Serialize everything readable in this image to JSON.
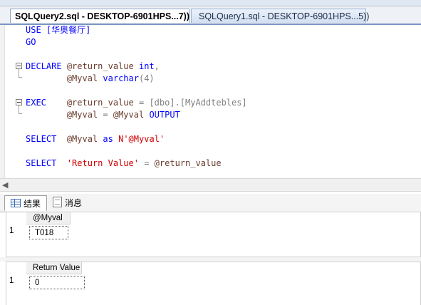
{
  "window": {
    "tabs": [
      {
        "label": "SQLQuery2.sql - DESKTOP-6901HPS...7))",
        "active": true
      },
      {
        "label": "SQLQuery1.sql - DESKTOP-6901HPS...5))",
        "active": false
      }
    ]
  },
  "editor": {
    "lines": {
      "l1_kw": "USE",
      "l1_db": "[华奥餐厅]",
      "l2_kw": "GO",
      "l4_kw": "DECLARE",
      "l4_var": "@return_value",
      "l4_type": "int",
      "l4_comma": ",",
      "l5_var": "@Myval",
      "l5_type": "varchar",
      "l5_paren": "(4)",
      "l7_kw": "EXEC",
      "l7_var": "@return_value",
      "l7_eq": "=",
      "l7_proc": "[dbo].[MyAddtebles]",
      "l8_var": "@Myval",
      "l8_eq": "=",
      "l8_var2": "@Myval",
      "l8_kw": "OUTPUT",
      "l10_kw": "SELECT",
      "l10_var": "@Myval",
      "l10_as": "as",
      "l10_str": "N'@Myval'",
      "l12_kw": "SELECT",
      "l12_str": "'Return Value'",
      "l12_eq": "=",
      "l12_var": "@return_value"
    }
  },
  "results": {
    "tabs": {
      "results_label": "结果",
      "messages_label": "消息"
    },
    "grid1": {
      "column": "@Myval",
      "row_number": "1",
      "value": "T018"
    },
    "grid2": {
      "column": "Return Value",
      "row_number": "1",
      "value": "0"
    }
  },
  "colors": {
    "keyword": "#0000ff",
    "variable": "#6a3b2c",
    "string": "#d00000",
    "punctuation": "#808080"
  }
}
